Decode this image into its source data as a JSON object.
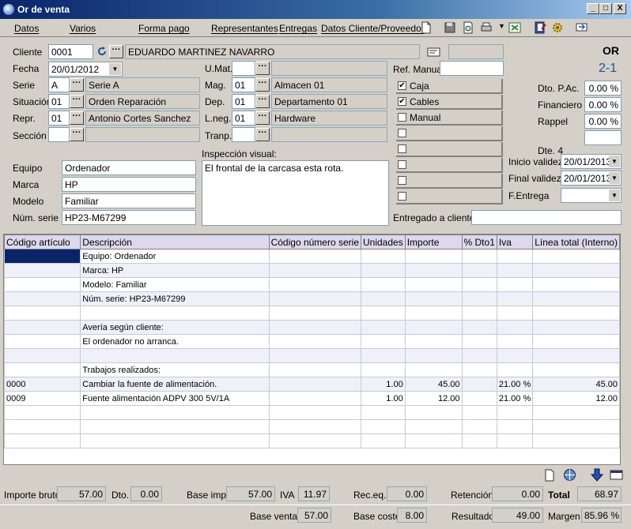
{
  "window": {
    "title": "Or de venta",
    "min": "_",
    "max": "□",
    "close": "X"
  },
  "menu": [
    "Datos",
    "Varios",
    "Forma pago",
    "Representantes",
    "Entregas",
    "Datos Cliente/Proveedor"
  ],
  "header": {
    "doc_type": "OR",
    "doc_number": "2-1"
  },
  "form": {
    "cliente_label": "Cliente",
    "cliente_code": "0001",
    "cliente_name": "EDUARDO MARTINEZ NAVARRO",
    "fecha_label": "Fecha",
    "fecha": "20/01/2012",
    "serie_label": "Serie",
    "serie_code": "A",
    "serie_name": "Serie A",
    "situacion_label": "Situación",
    "situacion_code": "01",
    "situacion_name": "Orden Reparación",
    "repr_label": "Repr.",
    "repr_code": "01",
    "repr_name": "Antonio Cortes Sanchez",
    "seccion_label": "Sección",
    "umat_label": "U.Mat.",
    "mag_label": "Mag.",
    "mag_code": "01",
    "mag_name": "Almacen 01",
    "dep_label": "Dep.",
    "dep_code": "01",
    "dep_name": "Departamento 01",
    "lneg_label": "L.neg.",
    "lneg_code": "01",
    "lneg_name": "Hardware",
    "tranp_label": "Tranp.",
    "refmanual_label": "Ref. Manual",
    "equipo_label": "Equipo",
    "equipo": "Ordenador",
    "marca_label": "Marca",
    "marca": "HP",
    "modelo_label": "Modelo",
    "modelo": "Familiar",
    "numserie_label": "Núm. serie",
    "numserie": "HP23-M67299",
    "inspeccion_label": "Inspección visual:",
    "inspeccion": "El frontal de la carcasa esta rota.",
    "checks": [
      {
        "label": "Caja",
        "checked": true
      },
      {
        "label": "Cables",
        "checked": true
      },
      {
        "label": "Manual",
        "checked": false
      },
      {
        "label": "",
        "checked": false
      },
      {
        "label": "",
        "checked": false
      },
      {
        "label": "",
        "checked": false
      },
      {
        "label": "",
        "checked": false
      },
      {
        "label": "",
        "checked": false
      }
    ],
    "dto_pac_label": "Dto. P.Ac.",
    "dto_pac": "0.00 %",
    "financiero_label": "Financiero",
    "financiero": "0.00 %",
    "rappel_label": "Rappel",
    "rappel": "0.00 %",
    "dte4_label": "Dte. 4",
    "inicio_label": "Inicio validez",
    "inicio": "20/01/2013",
    "final_label": "Final validez",
    "final": "20/01/2013",
    "fentrega_label": "F.Entrega",
    "entregado_label": "Entregado a cliente"
  },
  "table": {
    "headers": [
      "Código artículo",
      "Descripción",
      "Código número serie",
      "Unidades",
      "Importe",
      "% Dto1",
      "Iva",
      "Línea total (Interno)"
    ],
    "rows": [
      [
        "",
        "Equipo: Ordenador",
        "",
        "",
        "",
        "",
        "",
        ""
      ],
      [
        "",
        "Marca: HP",
        "",
        "",
        "",
        "",
        "",
        ""
      ],
      [
        "",
        "Modelo: Familiar",
        "",
        "",
        "",
        "",
        "",
        ""
      ],
      [
        "",
        "Núm. serie: HP23-M67299",
        "",
        "",
        "",
        "",
        "",
        ""
      ],
      [
        "",
        "",
        "",
        "",
        "",
        "",
        "",
        ""
      ],
      [
        "",
        "Avería según cliente:",
        "",
        "",
        "",
        "",
        "",
        ""
      ],
      [
        "",
        "El ordenador no arranca.",
        "",
        "",
        "",
        "",
        "",
        ""
      ],
      [
        "",
        "",
        "",
        "",
        "",
        "",
        "",
        ""
      ],
      [
        "",
        "Trabajos realizados:",
        "",
        "",
        "",
        "",
        "",
        ""
      ],
      [
        "0000",
        "Cambiar la fuente de alimentación.",
        "",
        "1.00",
        "45.00",
        "",
        "21.00 %",
        "45.00"
      ],
      [
        "0009",
        "Fuente alimentación ADPV 300 5V/1A",
        "",
        "1.00",
        "12.00",
        "",
        "21.00 %",
        "12.00"
      ]
    ]
  },
  "totals": {
    "importe_bruto_label": "Importe bruto",
    "importe_bruto": "57.00",
    "dto_label": "Dto.",
    "dto": "0.00",
    "base_imp_label": "Base imp.",
    "base_imp": "57.00",
    "iva_label": "IVA",
    "iva": "11.97",
    "receq_label": "Rec.eq.",
    "receq": "0.00",
    "retencion_label": "Retención",
    "retencion": "0.00",
    "total_label": "Total",
    "total": "68.97",
    "base_venta_label": "Base venta",
    "base_venta": "57.00",
    "base_coste_label": "Base coste",
    "base_coste": "8.00",
    "resultado_label": "Resultado",
    "resultado": "49.00",
    "margen_label": "Margen",
    "margen": "85.96 %"
  }
}
